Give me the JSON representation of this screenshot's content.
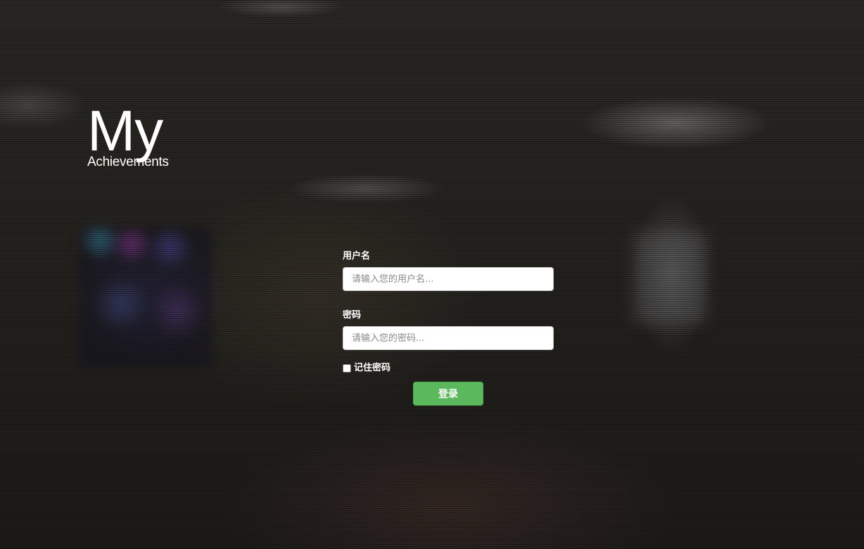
{
  "brand": {
    "title": "My",
    "subtitle": "Achievements"
  },
  "login_form": {
    "username": {
      "label": "用户名",
      "placeholder": "请输入您的用户名...",
      "value": ""
    },
    "password": {
      "label": "密码",
      "placeholder": "请输入您的密码...",
      "value": ""
    },
    "remember": {
      "label": "记住密码",
      "checked": false
    },
    "submit_label": "登录"
  },
  "colors": {
    "accent": "#5cb85c",
    "text": "#ffffff"
  }
}
